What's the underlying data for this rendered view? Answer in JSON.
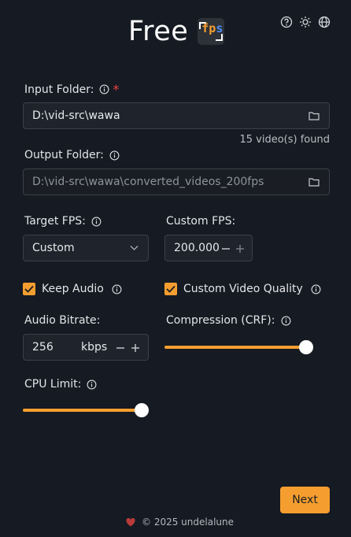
{
  "header": {
    "title": "Free",
    "logo_text_fp": "fp",
    "logo_text_s": "s",
    "icons": [
      "help-icon",
      "sun-icon",
      "globe-icon"
    ]
  },
  "input_folder": {
    "label": "Input Folder:",
    "required_mark": "*",
    "value": "D:\\vid-src\\wawa",
    "found_text": "15 video(s) found"
  },
  "output_folder": {
    "label": "Output Folder:",
    "value": "D:\\vid-src\\wawa\\converted_videos_200fps"
  },
  "target_fps": {
    "label": "Target FPS:",
    "selected": "Custom"
  },
  "custom_fps": {
    "label": "Custom FPS:",
    "value": "200.000"
  },
  "keep_audio": {
    "label": "Keep Audio",
    "checked": true
  },
  "custom_quality": {
    "label": "Custom Video Quality",
    "checked": true
  },
  "audio_bitrate": {
    "label": "Audio Bitrate:",
    "value": "256",
    "unit": "kbps"
  },
  "compression": {
    "label": "Compression (CRF):",
    "level": 1.0
  },
  "cpu_limit": {
    "label": "CPU Limit:",
    "level": 1.0
  },
  "actions": {
    "next_label": "Next"
  },
  "footer": {
    "text": "© 2025 undelalune"
  },
  "colors": {
    "accent": "#f59e2f",
    "background": "#161a22",
    "field": "#1f232b",
    "required": "#ef4444"
  }
}
